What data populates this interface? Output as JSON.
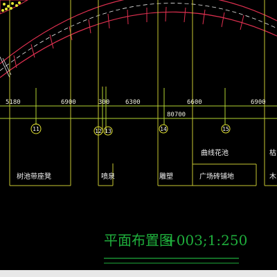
{
  "drawing": {
    "title": "平面布置图",
    "scale_text": "+003;1:250",
    "dimensions": [
      "5180",
      "6900",
      "300",
      "6300",
      "6600",
      "6900"
    ],
    "total_dimension": "80700",
    "grid_labels": [
      "11",
      "12",
      "13",
      "14",
      "15"
    ],
    "zone_labels": [
      "树池带座凳",
      "喷泉",
      "雕塑",
      "曲线花池",
      "广场砖铺地",
      "枯",
      "木"
    ],
    "colors": {
      "background": "#000000",
      "dimension_line": "#b4d432",
      "wall_line": "#d02040",
      "arc_line": "#e03050",
      "guide_line": "#c8c832",
      "title": "#1fae3c",
      "circle": "#e6e632"
    }
  }
}
